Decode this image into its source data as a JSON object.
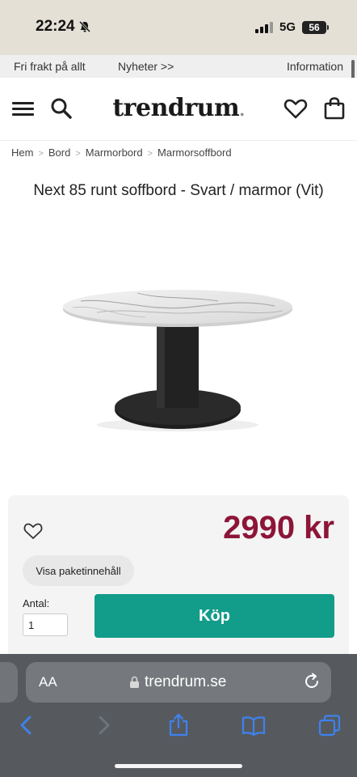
{
  "status": {
    "time": "22:24",
    "network": "5G",
    "battery": "56"
  },
  "infobar": {
    "free_shipping": "Fri frakt på allt",
    "news": "Nyheter >>",
    "information": "Information"
  },
  "header": {
    "logo": "trendrum",
    "logo_dot": "."
  },
  "breadcrumb": [
    "Hem",
    "Bord",
    "Marmorbord",
    "Marmorsoffbord"
  ],
  "product": {
    "title": "Next 85 runt soffbord - Svart / marmor (Vit)",
    "price": "2990 kr",
    "package_button": "Visa paketinnehåll",
    "qty_label": "Antal:",
    "qty_value": "1",
    "buy_button": "Köp"
  },
  "browser": {
    "text_size_label": "AA",
    "url": "trendrum.se"
  },
  "colors": {
    "price": "#8c1538",
    "buy_button": "#129c8a",
    "status_bar": "#e4e0d6",
    "browser_chrome": "#565a5f"
  }
}
